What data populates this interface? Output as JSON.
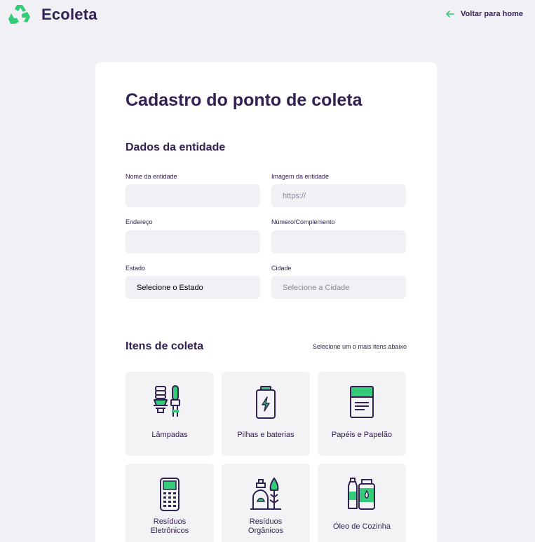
{
  "header": {
    "app_name": "Ecoleta",
    "back_label": "Voltar para home"
  },
  "form": {
    "title": "Cadastro do ponto de coleta",
    "entity_section": {
      "title": "Dados da entidade",
      "name": {
        "label": "Nome da entidade",
        "value": "",
        "placeholder": ""
      },
      "image": {
        "label": "Imagem da entidade",
        "value": "",
        "placeholder": "https://"
      },
      "address": {
        "label": "Endereço",
        "value": "",
        "placeholder": ""
      },
      "number": {
        "label": "Número/Complemento",
        "value": "",
        "placeholder": ""
      },
      "state": {
        "label": "Estado",
        "selected": "Selecione o Estado"
      },
      "city": {
        "label": "Cidade",
        "selected": "Selecione a Cidade"
      }
    },
    "items_section": {
      "title": "Itens de coleta",
      "hint": "Selecione um o mais itens abaixo",
      "items": [
        {
          "label": "Lâmpadas",
          "icon": "lamps-icon"
        },
        {
          "label": "Pilhas e baterias",
          "icon": "battery-icon"
        },
        {
          "label": "Papéis e Papelão",
          "icon": "paper-icon"
        },
        {
          "label_line1": "Resíduos",
          "label_line2": "Eletrônicos",
          "icon": "electronics-icon"
        },
        {
          "label_line1": "Resíduos",
          "label_line2": "Orgânicos",
          "icon": "organic-icon"
        },
        {
          "label": "Óleo de Cozinha",
          "icon": "oil-icon"
        }
      ]
    }
  },
  "colors": {
    "brand": "#322153",
    "accent": "#34cb79",
    "background": "#f0f0f5",
    "card": "#ffffff"
  }
}
